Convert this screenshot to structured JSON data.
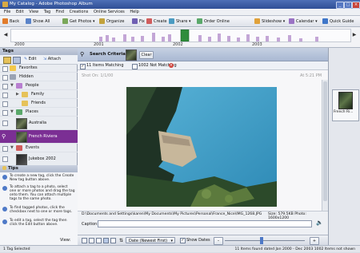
{
  "window": {
    "title": "My Catalog - Adobe Photoshop Album"
  },
  "menu": [
    "File",
    "Edit",
    "View",
    "Tag",
    "Find",
    "Creations",
    "Online Services",
    "Help"
  ],
  "toolbar": {
    "back": "Back",
    "show_all": "Show All",
    "get_photos": "Get Photos ▾",
    "organize": "Organize",
    "fix": "Fix",
    "create": "Create",
    "share": "Share ▾",
    "order_online": "Order Online",
    "slideshow": "Slideshow ▾",
    "calendar": "Calendar ▾",
    "quick_guide": "Quick Guide"
  },
  "timeline": {
    "years": [
      "2000",
      "2001",
      "2002",
      "2003"
    ]
  },
  "tags_panel": {
    "header": "Tags",
    "edit": "Edit",
    "attach": "Attach",
    "items": [
      {
        "label": "Favorites"
      },
      {
        "label": "Hidden"
      },
      {
        "label": "People"
      },
      {
        "label": "Family"
      },
      {
        "label": "Friends"
      },
      {
        "label": "Places"
      },
      {
        "label": "Australia"
      },
      {
        "label": "French Riviera"
      },
      {
        "label": "Events"
      },
      {
        "label": "Jukebox 2002"
      }
    ]
  },
  "tips": {
    "header": "Tips",
    "items": [
      "To create a new tag, click the Create New tag button above.",
      "To attach a tag to a photo, select one or more photos and drag the tag onto them. You can attach multiple tags to the same photo.",
      "To find tagged photos, click the checkbox next to one or more tags.",
      "To edit a tag, select the tag then click the Edit button above."
    ]
  },
  "search": {
    "label": "Search Criteria:",
    "clear": "Clear",
    "best_matching": "11 Items Matching",
    "not_matching": "1002 Not Matching"
  },
  "photo": {
    "date": "Shot On: 1/1/00",
    "time": "At 5:21 PM",
    "path": "D:\\Documents and Settings\\karen\\My Documents\\My Pictures\\Personal\\France_Nice\\IMG_1268.JPG",
    "size": "Size: 579.5KB Photo: 1600x1200",
    "caption_label": "Caption:",
    "caption_value": ""
  },
  "view_bar": {
    "label": "View:",
    "sort": "Date (Newest First)",
    "show_dates": "Show Dates"
  },
  "right_panel": {
    "thumb_label": "French Ri..."
  },
  "status": {
    "left": "1 Tag Selected",
    "right": "11 Items found dated Jan 2000 - Dec 2003  1002 Items not shown"
  }
}
